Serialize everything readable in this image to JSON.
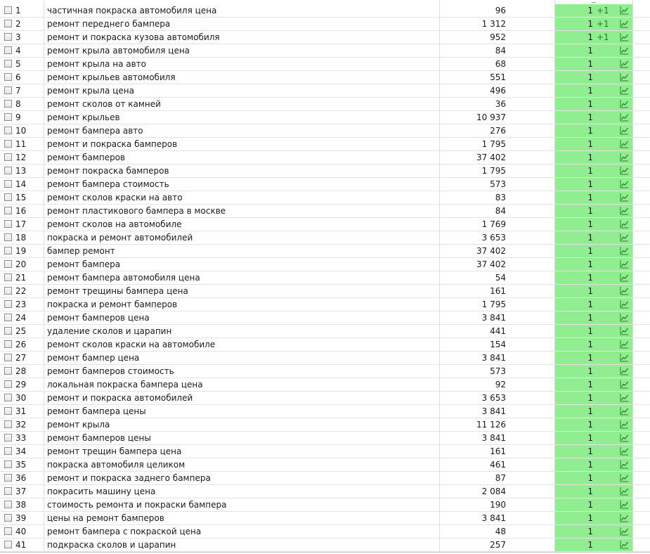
{
  "columns": {
    "checkbox": "",
    "number": "",
    "keyword": "",
    "volume": "",
    "position": ""
  },
  "colors": {
    "position_bg": "#90ee90",
    "delta_text": "#1a7f1a",
    "chart_icon": "#2e7d2e"
  },
  "icons": {
    "row_checkbox": "checkbox-icon",
    "row_chart": "line-chart-icon"
  },
  "rows": [
    {
      "n": "1",
      "keyword": "частичная покраска автомобиля цена",
      "volume": "96",
      "position": "1",
      "delta": "+1"
    },
    {
      "n": "2",
      "keyword": "ремонт переднего бампера",
      "volume": "1 312",
      "position": "1",
      "delta": "+1"
    },
    {
      "n": "3",
      "keyword": "ремонт и покраска кузова автомобиля",
      "volume": "952",
      "position": "1",
      "delta": "+1"
    },
    {
      "n": "4",
      "keyword": "ремонт крыла автомобиля цена",
      "volume": "84",
      "position": "1",
      "delta": ""
    },
    {
      "n": "5",
      "keyword": "ремонт крыла на авто",
      "volume": "68",
      "position": "1",
      "delta": ""
    },
    {
      "n": "6",
      "keyword": "ремонт крыльев автомобиля",
      "volume": "551",
      "position": "1",
      "delta": ""
    },
    {
      "n": "7",
      "keyword": "ремонт крыла цена",
      "volume": "496",
      "position": "1",
      "delta": ""
    },
    {
      "n": "8",
      "keyword": "ремонт сколов от камней",
      "volume": "36",
      "position": "1",
      "delta": ""
    },
    {
      "n": "9",
      "keyword": "ремонт крыльев",
      "volume": "10 937",
      "position": "1",
      "delta": ""
    },
    {
      "n": "10",
      "keyword": "ремонт бампера авто",
      "volume": "276",
      "position": "1",
      "delta": ""
    },
    {
      "n": "11",
      "keyword": "ремонт и покраска бамперов",
      "volume": "1 795",
      "position": "1",
      "delta": ""
    },
    {
      "n": "12",
      "keyword": "ремонт бамперов",
      "volume": "37 402",
      "position": "1",
      "delta": ""
    },
    {
      "n": "13",
      "keyword": "ремонт покраска бамперов",
      "volume": "1 795",
      "position": "1",
      "delta": ""
    },
    {
      "n": "14",
      "keyword": "ремонт бампера стоимость",
      "volume": "573",
      "position": "1",
      "delta": ""
    },
    {
      "n": "15",
      "keyword": "ремонт сколов краски на авто",
      "volume": "83",
      "position": "1",
      "delta": ""
    },
    {
      "n": "16",
      "keyword": "ремонт пластикового бампера в москве",
      "volume": "84",
      "position": "1",
      "delta": ""
    },
    {
      "n": "17",
      "keyword": "ремонт сколов на автомобиле",
      "volume": "1 769",
      "position": "1",
      "delta": ""
    },
    {
      "n": "18",
      "keyword": "покраска и ремонт автомобилей",
      "volume": "3 653",
      "position": "1",
      "delta": ""
    },
    {
      "n": "19",
      "keyword": "бампер ремонт",
      "volume": "37 402",
      "position": "1",
      "delta": ""
    },
    {
      "n": "20",
      "keyword": "ремонт бампера",
      "volume": "37 402",
      "position": "1",
      "delta": ""
    },
    {
      "n": "21",
      "keyword": "ремонт бампера автомобиля цена",
      "volume": "54",
      "position": "1",
      "delta": ""
    },
    {
      "n": "22",
      "keyword": "ремонт трещины бампера цена",
      "volume": "161",
      "position": "1",
      "delta": ""
    },
    {
      "n": "23",
      "keyword": "покраска и ремонт бамперов",
      "volume": "1 795",
      "position": "1",
      "delta": ""
    },
    {
      "n": "24",
      "keyword": "ремонт бамперов цена",
      "volume": "3 841",
      "position": "1",
      "delta": ""
    },
    {
      "n": "25",
      "keyword": "удаление сколов и царапин",
      "volume": "441",
      "position": "1",
      "delta": ""
    },
    {
      "n": "26",
      "keyword": "ремонт сколов краски на автомобиле",
      "volume": "154",
      "position": "1",
      "delta": ""
    },
    {
      "n": "27",
      "keyword": "ремонт бампер цена",
      "volume": "3 841",
      "position": "1",
      "delta": ""
    },
    {
      "n": "28",
      "keyword": "ремонт бамперов стоимость",
      "volume": "573",
      "position": "1",
      "delta": ""
    },
    {
      "n": "29",
      "keyword": "локальная покраска бампера цена",
      "volume": "92",
      "position": "1",
      "delta": ""
    },
    {
      "n": "30",
      "keyword": "ремонт и покраска автомобилей",
      "volume": "3 653",
      "position": "1",
      "delta": ""
    },
    {
      "n": "31",
      "keyword": "ремонт бампера цены",
      "volume": "3 841",
      "position": "1",
      "delta": ""
    },
    {
      "n": "32",
      "keyword": "ремонт крыла",
      "volume": "11 126",
      "position": "1",
      "delta": ""
    },
    {
      "n": "33",
      "keyword": "ремонт бамперов цены",
      "volume": "3 841",
      "position": "1",
      "delta": ""
    },
    {
      "n": "34",
      "keyword": "ремонт трещин бампера цена",
      "volume": "161",
      "position": "1",
      "delta": ""
    },
    {
      "n": "35",
      "keyword": "покраска автомобиля целиком",
      "volume": "461",
      "position": "1",
      "delta": ""
    },
    {
      "n": "36",
      "keyword": "ремонт и покраска заднего бампера",
      "volume": "87",
      "position": "1",
      "delta": ""
    },
    {
      "n": "37",
      "keyword": "покрасить машину цена",
      "volume": "2 084",
      "position": "1",
      "delta": ""
    },
    {
      "n": "38",
      "keyword": "стоимость ремонта и покраски бампера",
      "volume": "190",
      "position": "1",
      "delta": ""
    },
    {
      "n": "39",
      "keyword": "цены на ремонт бамперов",
      "volume": "3 841",
      "position": "1",
      "delta": ""
    },
    {
      "n": "40",
      "keyword": "ремонт бампера с покраской цена",
      "volume": "48",
      "position": "1",
      "delta": ""
    },
    {
      "n": "41",
      "keyword": "подкраска сколов и царапин",
      "volume": "257",
      "position": "1",
      "delta": ""
    }
  ]
}
